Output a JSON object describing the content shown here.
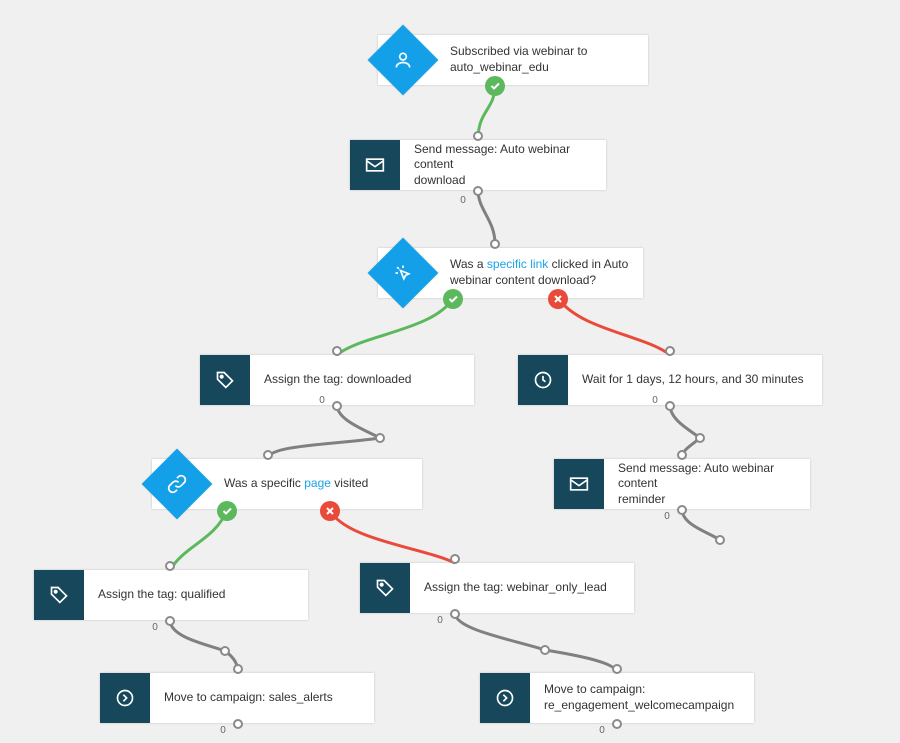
{
  "zero": "0",
  "nodes": {
    "trigger": {
      "text_a": "Subscribed via webinar to",
      "text_b": "auto_webinar_edu"
    },
    "send1": {
      "text_a": "Send message: Auto webinar content",
      "text_b": "download"
    },
    "cond_link": {
      "pre": "Was a ",
      "link": "specific link",
      "post_a": " clicked in Auto",
      "post_b": "webinar content download?"
    },
    "tag_dl": {
      "text": "Assign the tag: downloaded"
    },
    "wait": {
      "text": "Wait for 1 days, 12 hours, and 30 minutes"
    },
    "cond_page": {
      "pre": "Was a specific ",
      "link": "page",
      "post": " visited"
    },
    "send2": {
      "text_a": "Send message: Auto webinar content",
      "text_b": "reminder"
    },
    "tag_q": {
      "text": "Assign the tag: qualified"
    },
    "tag_wol": {
      "text": "Assign the tag: webinar_only_lead"
    },
    "move1": {
      "text": "Move to campaign: sales_alerts"
    },
    "move2": {
      "text_a": "Move to campaign:",
      "text_b": "re_engagement_welcomecampaign"
    }
  }
}
